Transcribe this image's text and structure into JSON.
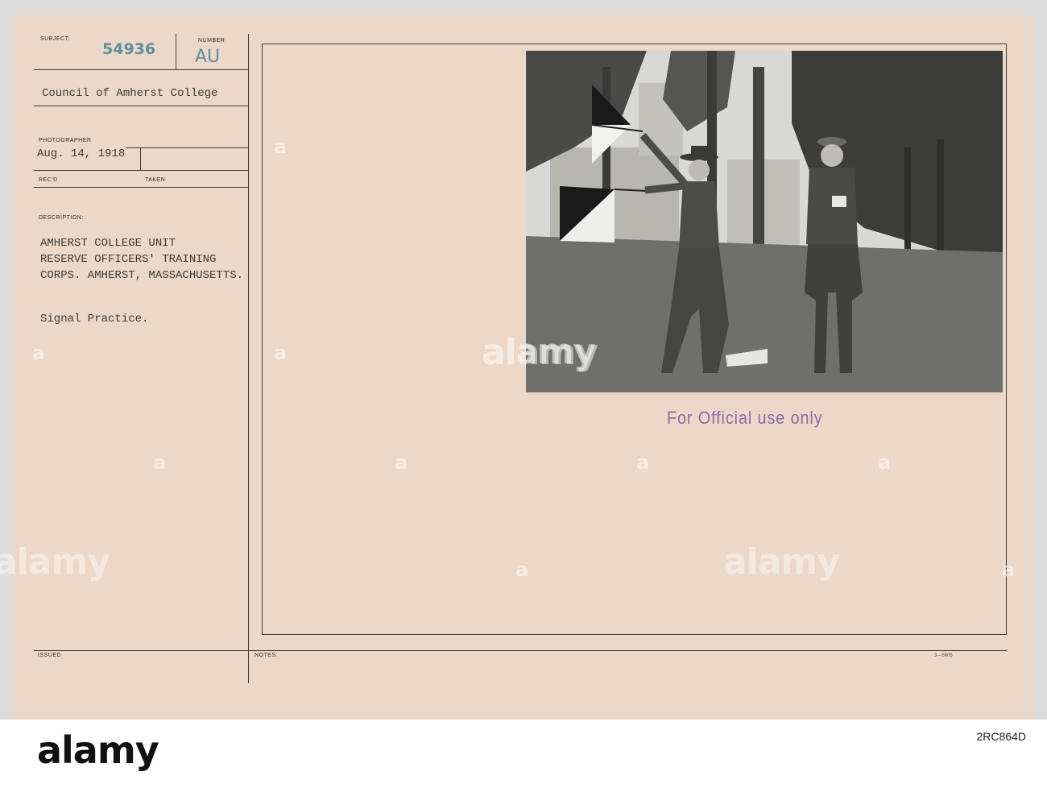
{
  "form": {
    "subject_label": "SUBJECT:",
    "subject_number": "54936",
    "number_label": "NUMBER",
    "number_value": "AU",
    "source": "Council of Amherst College",
    "photographer_label": "PHOTOGRAPHER",
    "date": "Aug. 14, 1918",
    "recd_label": "REC'D",
    "taken_label": "TAKEN",
    "description_label": "DESCRIPTION:",
    "description_lines": [
      "AMHERST COLLEGE UNIT",
      "RESERVE OFFICERS' TRAINING",
      "CORPS. AMHERST, MASSACHUSETTS."
    ],
    "caption": "Signal Practice.",
    "issued_label": "ISSUED",
    "notes_label": "NOTES:",
    "stamp": "For Official use only",
    "form_code": "3—5605"
  },
  "photo": {
    "scene": "signal-practice-photograph",
    "colors": {
      "sky": "#dcdcdc",
      "grass": "#6e6e6e",
      "tree": "#3a3a3a",
      "uniform": "#4a4a48"
    }
  },
  "watermark": {
    "brand": "alamy",
    "image_id": "2RC864D",
    "colors": {
      "strip": "#ffffff",
      "text": "#111111"
    }
  }
}
